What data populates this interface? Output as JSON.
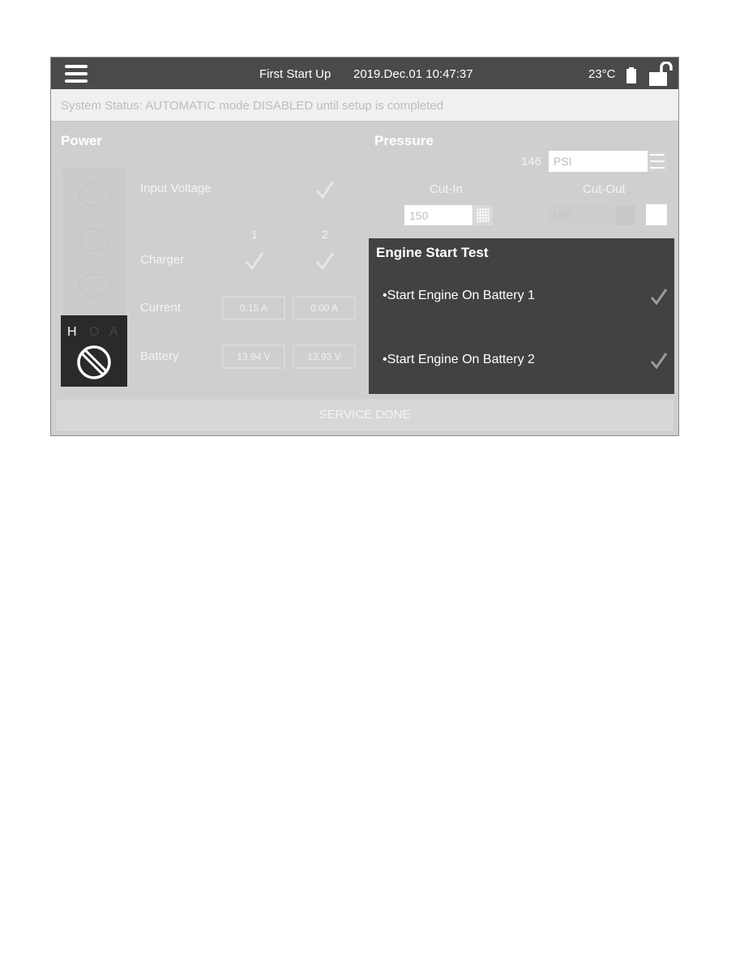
{
  "header": {
    "title": "First Start Up",
    "datetime": "2019.Dec.01 10:47:37",
    "temperature": "23°C",
    "icons": {
      "menu": "hamburger-menu-icon",
      "battery": "battery-icon",
      "lock": "unlocked-padlock-icon"
    }
  },
  "status": {
    "text": "System Status: AUTOMATIC mode DISABLED until setup is completed"
  },
  "power": {
    "title": "Power",
    "hoa": {
      "h": "H",
      "o": "O",
      "a": "A",
      "selected": "H",
      "icon": "selector-dial-icon"
    },
    "input_voltage_label": "Input Voltage",
    "column_headers": [
      "1",
      "2"
    ],
    "charger_label": "Charger",
    "current_label": "Current",
    "current_values": [
      "0.15 A",
      "0.00 A"
    ],
    "battery_label": "Battery",
    "battery_values": [
      "13.94 V",
      "13.93 V"
    ]
  },
  "pressure": {
    "title": "Pressure",
    "reading": "146",
    "unit": "PSI",
    "cut_in_label": "Cut-In",
    "cut_in_value": "150",
    "cut_out_label": "Cut-Out",
    "cut_out_value": "160"
  },
  "engine_test": {
    "title": "Engine Start Test",
    "items": [
      {
        "label": "•Start Engine On Battery 1"
      },
      {
        "label": "•Start Engine On Battery 2"
      }
    ]
  },
  "footer": {
    "service_button": "SERVICE DONE"
  },
  "colors": {
    "topbar": "#4a4a4a",
    "panel": "#cfcfcf",
    "engine_panel": "#424242",
    "hoa_box": "#2a2a2a"
  }
}
